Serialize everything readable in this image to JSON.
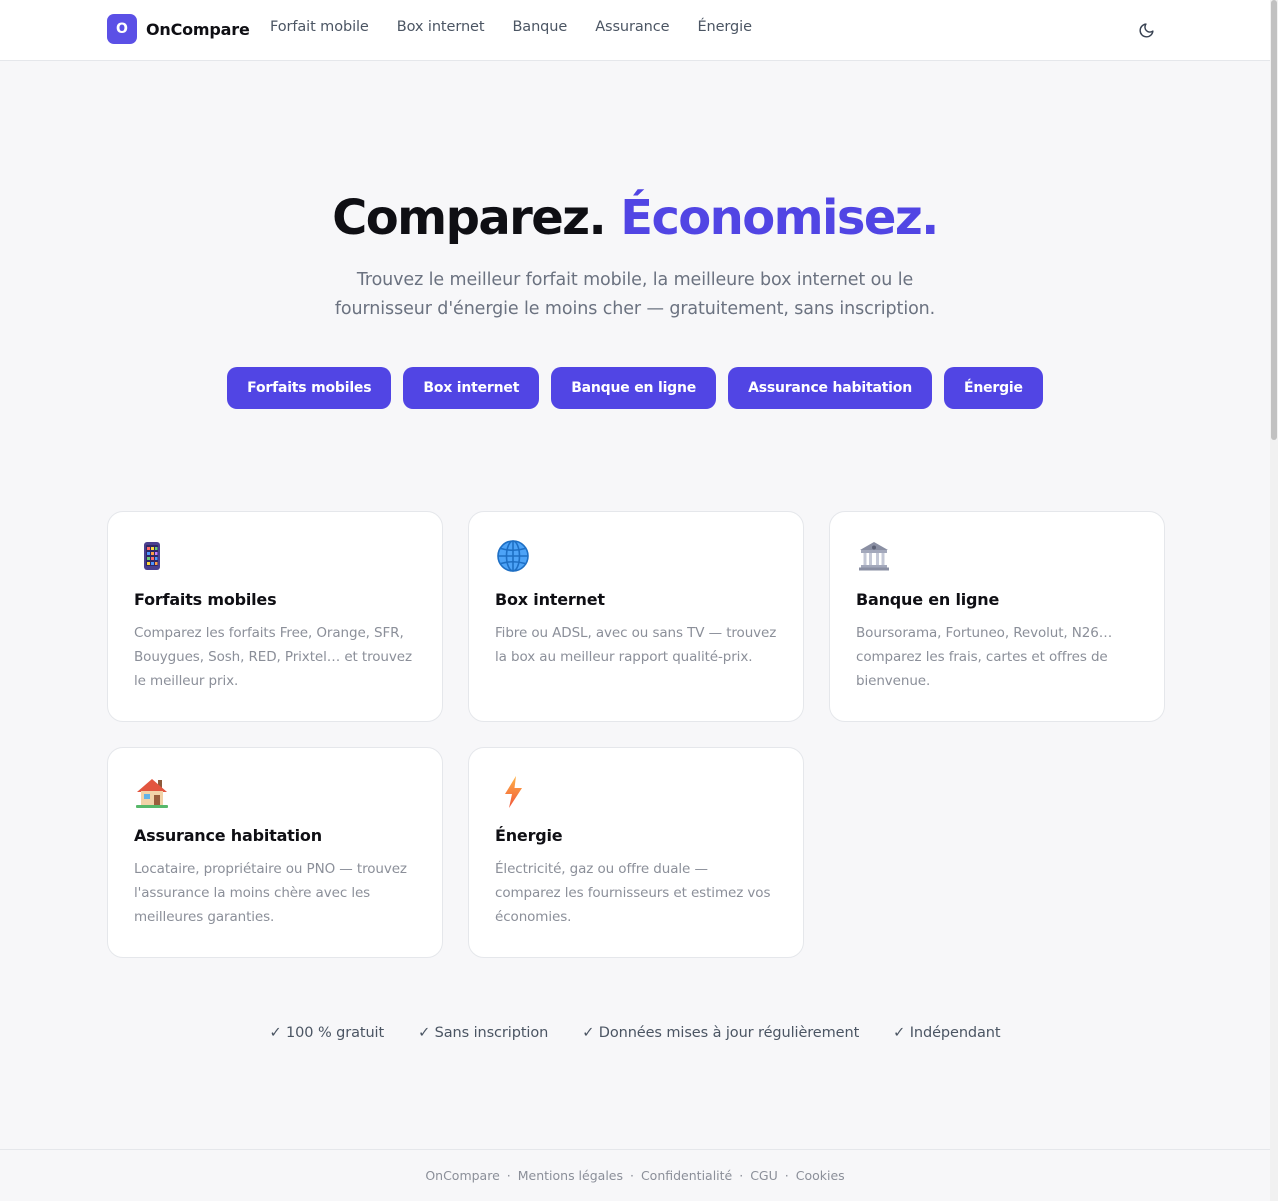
{
  "header": {
    "logo_letter": "O",
    "brand": "OnCompare",
    "nav": [
      {
        "label": "Forfait mobile"
      },
      {
        "label": "Box internet"
      },
      {
        "label": "Banque"
      },
      {
        "label": "Assurance"
      },
      {
        "label": "Énergie"
      }
    ],
    "theme_icon": "moon-icon"
  },
  "hero": {
    "title_main": "Comparez.",
    "title_accent": "Économisez.",
    "subtitle": "Trouvez le meilleur forfait mobile, la meilleure box internet ou le fournisseur d'énergie le moins cher — gratuitement, sans inscription.",
    "ctas": [
      {
        "label": "Forfaits mobiles"
      },
      {
        "label": "Box internet"
      },
      {
        "label": "Banque en ligne"
      },
      {
        "label": "Assurance habitation"
      },
      {
        "label": "Énergie"
      }
    ]
  },
  "cards": [
    {
      "icon": "mobile-phone-icon",
      "title": "Forfaits mobiles",
      "description": "Comparez les forfaits Free, Orange, SFR, Bouygues, Sosh, RED, Prixtel… et trouvez le meilleur prix."
    },
    {
      "icon": "globe-icon",
      "title": "Box internet",
      "description": "Fibre ou ADSL, avec ou sans TV — trouvez la box au meilleur rapport qualité-prix."
    },
    {
      "icon": "bank-icon",
      "title": "Banque en ligne",
      "description": "Boursorama, Fortuneo, Revolut, N26… comparez les frais, cartes et offres de bienvenue."
    },
    {
      "icon": "house-icon",
      "title": "Assurance habitation",
      "description": "Locataire, propriétaire ou PNO — trouvez l'assurance la moins chère avec les meilleures garanties."
    },
    {
      "icon": "lightning-icon",
      "title": "Énergie",
      "description": "Électricité, gaz ou offre duale — comparez les fournisseurs et estimez vos économies."
    }
  ],
  "features": [
    {
      "label": "✓ 100 % gratuit"
    },
    {
      "label": "✓ Sans inscription"
    },
    {
      "label": "✓ Données mises à jour régulièrement"
    },
    {
      "label": "✓ Indépendant"
    }
  ],
  "footer": {
    "brand": "OnCompare",
    "links": [
      {
        "label": "Mentions légales"
      },
      {
        "label": "Confidentialité"
      },
      {
        "label": "CGU"
      },
      {
        "label": "Cookies"
      }
    ],
    "separator": "·"
  },
  "colors": {
    "accent": "#5145e4",
    "background": "#f7f7f9",
    "text": "#0f0f14",
    "muted": "#6b7280"
  }
}
